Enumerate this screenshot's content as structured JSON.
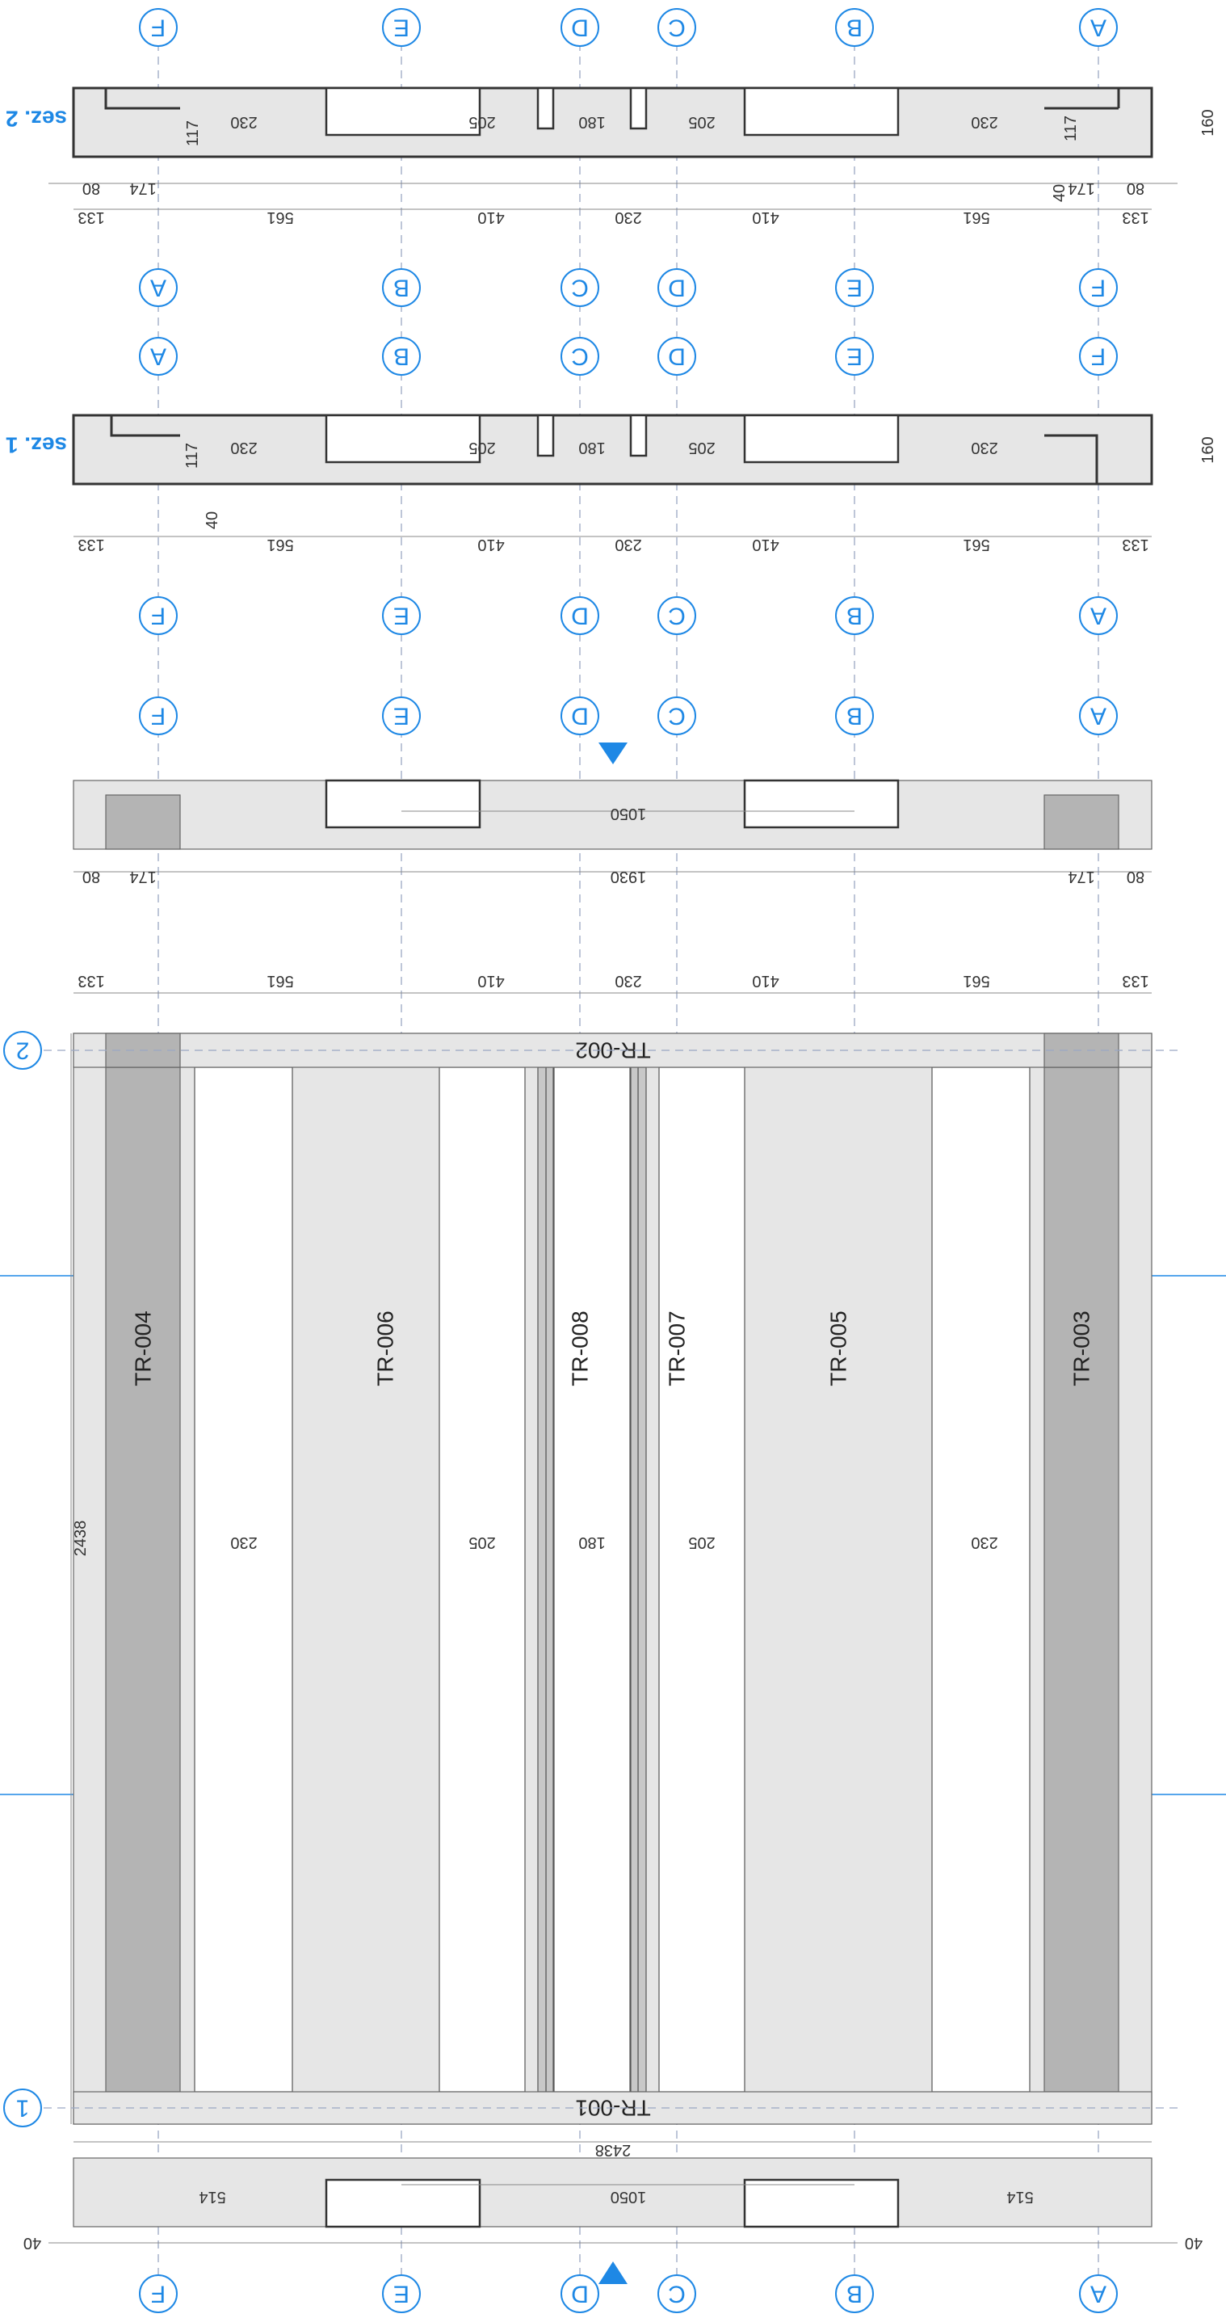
{
  "drawing": {
    "orientation": "rotated 180 degrees",
    "colors": {
      "bubble": "#1e88e5",
      "slab": "#e6e6e6",
      "beam": "#b4b4b4",
      "grid": "#9aa7c4"
    },
    "axes": {
      "A": "A",
      "B": "B",
      "C": "C",
      "D": "D",
      "E": "E",
      "F": "F",
      "row1": "1",
      "row2": "2"
    },
    "sections": {
      "sez1": "sez. 1",
      "sez2": "sez. 2"
    },
    "beams": {
      "tr001": "TR-001",
      "tr002": "TR-002",
      "tr003": "TR-003",
      "tr004": "TR-004",
      "tr005": "TR-005",
      "tr006": "TR-006",
      "tr007": "TR-007",
      "tr008": "TR-008"
    },
    "dims": {
      "d40": "40",
      "d80": "80",
      "d117": "117",
      "d133": "133",
      "d160": "160",
      "d174": "174",
      "d180": "180",
      "d205": "205",
      "d230": "230",
      "d410": "410",
      "d514": "514",
      "d561": "561",
      "d1050": "1050",
      "d1930": "1930",
      "d2438": "2438"
    }
  }
}
